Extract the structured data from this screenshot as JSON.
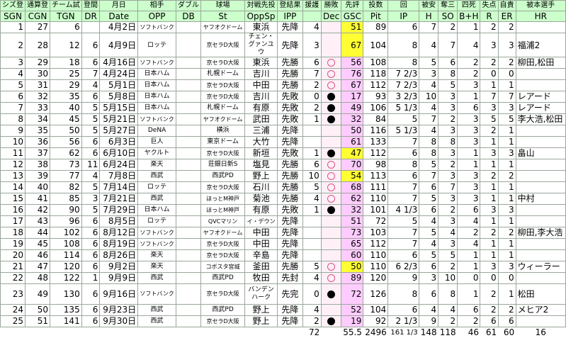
{
  "header_top": [
    "シズ登",
    "通算登",
    "チーム試",
    "登間",
    "月日",
    "相手",
    "ダブル",
    "球場",
    "対戦先投",
    "登結果",
    "援護",
    "勝敗",
    "先評",
    "投数",
    "回",
    "被安",
    "奪三",
    "四死",
    "失点",
    "自責",
    "被本選手"
  ],
  "header_sub": [
    "SGN",
    "CGN",
    "TGN",
    "DR",
    "Date",
    "OPP",
    "DB",
    "St",
    "OppSp",
    "IPP",
    "",
    "Dec",
    "GSC",
    "Pit",
    "IP",
    "H",
    "SO",
    "B+H",
    "R",
    "ER",
    "HR"
  ],
  "rows": [
    {
      "sgn": "1",
      "cgn": "27",
      "tgn": "6",
      "dr": "",
      "date": "4月2日",
      "opp": "ソフトバンク",
      "db": "",
      "st": "ヤフオクドーム",
      "oppsp": "東浜",
      "ipp": "先降",
      "sup": "4",
      "dec": "",
      "gsc": "51",
      "gscbg": "y",
      "pit": "89",
      "ip": "6",
      "h": "7",
      "so": "2",
      "bh": "1",
      "r": "2",
      "er": "2",
      "hr": ""
    },
    {
      "sgn": "2",
      "cgn": "28",
      "tgn": "12",
      "dr": "6",
      "date": "4月9日",
      "opp": "ロッテ",
      "db": "",
      "st": "京セラD大阪",
      "oppsp": "チェン・グァンユウ",
      "ipp": "先降",
      "sup": "3",
      "dec": "",
      "gsc": "67",
      "gscbg": "y",
      "pit": "104",
      "ip": "8",
      "h": "4",
      "so": "7",
      "bh": "4",
      "r": "3",
      "er": "3",
      "hr": "福浦2"
    },
    {
      "sgn": "3",
      "cgn": "29",
      "tgn": "18",
      "dr": "6",
      "date": "4月16日",
      "opp": "ソフトバンク",
      "db": "",
      "st": "京セラD大阪",
      "oppsp": "東浜",
      "ipp": "先勝",
      "sup": "6",
      "dec": "win",
      "gsc": "56",
      "gscbg": "p",
      "pit": "108",
      "ip": "8",
      "h": "5",
      "so": "6",
      "bh": "2",
      "r": "2",
      "er": "2",
      "hr": "柳田,松田"
    },
    {
      "sgn": "4",
      "cgn": "30",
      "tgn": "25",
      "dr": "7",
      "date": "4月24日",
      "opp": "日本ハム",
      "db": "",
      "st": "札幌ドーム",
      "oppsp": "吉川",
      "ipp": "先勝",
      "sup": "7",
      "dec": "win",
      "gsc": "76",
      "gscbg": "p",
      "pit": "118",
      "ip": "7 2/3",
      "h": "3",
      "so": "8",
      "bh": "2",
      "r": "0",
      "er": "0",
      "hr": ""
    },
    {
      "sgn": "5",
      "cgn": "31",
      "tgn": "29",
      "dr": "4",
      "date": "5月1日",
      "opp": "日本ハム",
      "db": "",
      "st": "京セラD大阪",
      "oppsp": "中田",
      "ipp": "先勝",
      "sup": "2",
      "dec": "win",
      "gsc": "67",
      "gscbg": "p",
      "pit": "112",
      "ip": "7 2/3",
      "h": "4",
      "so": "5",
      "bh": "3",
      "r": "1",
      "er": "1",
      "hr": ""
    },
    {
      "sgn": "6",
      "cgn": "32",
      "tgn": "35",
      "dr": "6",
      "date": "5月8日",
      "opp": "日本ハム",
      "db": "",
      "st": "京セラD大阪",
      "oppsp": "吉川",
      "ipp": "先敗",
      "sup": "0",
      "dec": "loss",
      "gsc": "17",
      "gscbg": "p",
      "pit": "93",
      "ip": "3 2/3",
      "h": "10",
      "so": "3",
      "bh": "1",
      "r": "7",
      "er": "7",
      "hr": "レアード"
    },
    {
      "sgn": "7",
      "cgn": "33",
      "tgn": "40",
      "dr": "5",
      "date": "5月15日",
      "opp": "日本ハム",
      "db": "",
      "st": "札幌ドーム",
      "oppsp": "有原",
      "ipp": "先敗",
      "sup": "2",
      "dec": "loss",
      "gsc": "49",
      "gscbg": "p",
      "pit": "106",
      "ip": "5 1/3",
      "h": "4",
      "so": "3",
      "bh": "6",
      "r": "3",
      "er": "3",
      "hr": "レアード"
    },
    {
      "sgn": "8",
      "cgn": "34",
      "tgn": "45",
      "dr": "5",
      "date": "5月21日",
      "opp": "ソフトバンク",
      "db": "",
      "st": "ヤフオクドーム",
      "oppsp": "武田",
      "ipp": "先敗",
      "sup": "1",
      "dec": "loss",
      "gsc": "32",
      "gscbg": "p",
      "pit": "84",
      "ip": "5",
      "h": "7",
      "so": "2",
      "bh": "3",
      "r": "5",
      "er": "5",
      "hr": "李大浩,松田"
    },
    {
      "sgn": "9",
      "cgn": "35",
      "tgn": "50",
      "dr": "5",
      "date": "5月27日",
      "opp": "DeNA",
      "db": "",
      "st": "横浜",
      "oppsp": "三浦",
      "ipp": "先降",
      "sup": "",
      "dec": "",
      "gsc": "50",
      "gscbg": "p",
      "pit": "116",
      "ip": "5 1/3",
      "h": "4",
      "so": "3",
      "bh": "3",
      "r": "2",
      "er": "1",
      "hr": ""
    },
    {
      "sgn": "10",
      "cgn": "36",
      "tgn": "56",
      "dr": "6",
      "date": "6月3日",
      "opp": "巨人",
      "db": "",
      "st": "東京ドーム",
      "oppsp": "大竹",
      "ipp": "先降",
      "sup": "",
      "dec": "",
      "gsc": "61",
      "gscbg": "p",
      "pit": "133",
      "ip": "7",
      "h": "8",
      "so": "8",
      "bh": "3",
      "r": "1",
      "er": "1",
      "hr": ""
    },
    {
      "sgn": "11",
      "cgn": "37",
      "tgn": "62",
      "dr": "6",
      "date": "6月10日",
      "opp": "ヤクルト",
      "db": "",
      "st": "京セラD大阪",
      "oppsp": "新垣",
      "ipp": "先敗",
      "sup": "1",
      "dec": "loss",
      "gsc": "47",
      "gscbg": "y",
      "pit": "112",
      "ip": "6",
      "h": "8",
      "so": "3",
      "bh": "1",
      "r": "3",
      "er": "3",
      "hr": "畠山"
    },
    {
      "sgn": "12",
      "cgn": "38",
      "tgn": "73",
      "dr": "11",
      "date": "6月24日",
      "opp": "楽天",
      "db": "",
      "st": "荘銀日新S",
      "oppsp": "塩見",
      "ipp": "先勝",
      "sup": "6",
      "dec": "win",
      "gsc": "70",
      "gscbg": "p",
      "pit": "98",
      "ip": "8",
      "h": "5",
      "so": "2",
      "bh": "1",
      "r": "1",
      "er": "1",
      "hr": ""
    },
    {
      "sgn": "13",
      "cgn": "39",
      "tgn": "77",
      "dr": "4",
      "date": "7月8日",
      "opp": "西武",
      "db": "",
      "st": "西武PD",
      "oppsp": "野上",
      "ipp": "先勝",
      "sup": "10",
      "dec": "win",
      "gsc": "54",
      "gscbg": "y",
      "pit": "113",
      "ip": "6",
      "h": "7",
      "so": "3",
      "bh": "3",
      "r": "2",
      "er": "2",
      "hr": ""
    },
    {
      "sgn": "14",
      "cgn": "40",
      "tgn": "82",
      "dr": "5",
      "date": "7月14日",
      "opp": "ロッテ",
      "db": "",
      "st": "京セラD大阪",
      "oppsp": "石川",
      "ipp": "先勝",
      "sup": "5",
      "dec": "win",
      "gsc": "68",
      "gscbg": "p",
      "pit": "111",
      "ip": "7",
      "h": "6",
      "so": "7",
      "bh": "3",
      "r": "1",
      "er": "1",
      "hr": ""
    },
    {
      "sgn": "15",
      "cgn": "41",
      "tgn": "85",
      "dr": "3",
      "date": "7月21日",
      "opp": "西武",
      "db": "",
      "st": "ほっとM神戸",
      "oppsp": "菊池",
      "ipp": "先勝",
      "sup": "4",
      "dec": "win",
      "gsc": "62",
      "gscbg": "p",
      "pit": "110",
      "ip": "7",
      "h": "5",
      "so": "3",
      "bh": "3",
      "r": "1",
      "er": "1",
      "hr": "中村"
    },
    {
      "sgn": "16",
      "cgn": "42",
      "tgn": "90",
      "dr": "5",
      "date": "7月29日",
      "opp": "日本ハム",
      "db": "",
      "st": "ほっとM神戸",
      "oppsp": "有原",
      "ipp": "先敗",
      "sup": "1",
      "dec": "loss",
      "gsc": "32",
      "gscbg": "p",
      "pit": "101",
      "ip": "4 1/3",
      "h": "6",
      "so": "2",
      "bh": "6",
      "r": "3",
      "er": "3",
      "hr": ""
    },
    {
      "sgn": "17",
      "cgn": "43",
      "tgn": "96",
      "dr": "6",
      "date": "8月5日",
      "opp": "ロッテ",
      "db": "",
      "st": "QVCマリン",
      "oppsp": "イ・デウン",
      "ipp": "先降",
      "sup": "",
      "dec": "",
      "gsc": "51",
      "gscbg": "p",
      "pit": "72",
      "ip": "5",
      "h": "4",
      "so": "3",
      "bh": "4",
      "r": "1",
      "er": "1",
      "hr": ""
    },
    {
      "sgn": "18",
      "cgn": "44",
      "tgn": "102",
      "dr": "6",
      "date": "8月12日",
      "opp": "ソフトバンク",
      "db": "",
      "st": "ヤフオクドーム",
      "oppsp": "中田",
      "ipp": "先降",
      "sup": "",
      "dec": "",
      "gsc": "73",
      "gscbg": "p",
      "pit": "103",
      "ip": "7",
      "h": "5",
      "so": "4",
      "bh": "2",
      "r": "2",
      "er": "2",
      "hr": "柳田,李大浩"
    },
    {
      "sgn": "19",
      "cgn": "45",
      "tgn": "108",
      "dr": "6",
      "date": "8月19日",
      "opp": "ソフトバンク",
      "db": "",
      "st": "京セラD大阪",
      "oppsp": "中田",
      "ipp": "先降",
      "sup": "",
      "dec": "",
      "gsc": "65",
      "gscbg": "p",
      "pit": "112",
      "ip": "7",
      "h": "4",
      "so": "3",
      "bh": "4",
      "r": "1",
      "er": "1",
      "hr": ""
    },
    {
      "sgn": "20",
      "cgn": "46",
      "tgn": "114",
      "dr": "6",
      "date": "8月26日",
      "opp": "楽天",
      "db": "",
      "st": "京セラD大阪",
      "oppsp": "辛島",
      "ipp": "先降",
      "sup": "",
      "dec": "",
      "gsc": "60",
      "gscbg": "p",
      "pit": "110",
      "ip": "6",
      "h": "5",
      "so": "5",
      "bh": "1",
      "r": "1",
      "er": "1",
      "hr": ""
    },
    {
      "sgn": "21",
      "cgn": "47",
      "tgn": "120",
      "dr": "6",
      "date": "9月2日",
      "opp": "楽天",
      "db": "",
      "st": "コボスタ宮城",
      "oppsp": "釜田",
      "ipp": "先勝",
      "sup": "5",
      "dec": "win",
      "gsc": "50",
      "gscbg": "y",
      "pit": "110",
      "ip": "6 2/3",
      "h": "6",
      "so": "2",
      "bh": "1",
      "r": "3",
      "er": "3",
      "hr": "ウィーラー"
    },
    {
      "sgn": "22",
      "cgn": "48",
      "tgn": "122",
      "dr": "1",
      "date": "9月9日",
      "opp": "西武",
      "db": "",
      "st": "西武PD",
      "oppsp": "牧田",
      "ipp": "先封",
      "sup": "4",
      "dec": "win",
      "gsc": "89",
      "gscbg": "p",
      "pit": "120",
      "ip": "9",
      "h": "3",
      "so": "10",
      "bh": "0",
      "r": "0",
      "er": "0",
      "hr": ""
    },
    {
      "sgn": "23",
      "cgn": "49",
      "tgn": "130",
      "dr": "6",
      "date": "9月16日",
      "opp": "ソフトバンク",
      "db": "",
      "st": "京セラD大阪",
      "oppsp": "バンデンハーク",
      "ipp": "先完",
      "sup": "0",
      "dec": "loss",
      "gsc": "72",
      "gscbg": "p",
      "pit": "126",
      "ip": "8",
      "h": "6",
      "so": "8",
      "bh": "1",
      "r": "2",
      "er": "1",
      "hr": "松田"
    },
    {
      "sgn": "24",
      "cgn": "50",
      "tgn": "135",
      "dr": "6",
      "date": "9月23日",
      "opp": "西武",
      "db": "",
      "st": "西武PD",
      "oppsp": "野上",
      "ipp": "先降",
      "sup": "4",
      "dec": "",
      "gsc": "52",
      "gscbg": "p",
      "pit": "104",
      "ip": "6",
      "h": "4",
      "so": "4",
      "bh": "6",
      "r": "2",
      "er": "2",
      "hr": "メヒア2"
    },
    {
      "sgn": "25",
      "cgn": "51",
      "tgn": "141",
      "dr": "6",
      "date": "9月30日",
      "opp": "西武",
      "db": "",
      "st": "京セラD大阪",
      "oppsp": "野上",
      "ipp": "先降",
      "sup": "2",
      "dec": "loss",
      "gsc": "19",
      "gscbg": "p",
      "pit": "92",
      "ip": "2 1/3",
      "h": "9",
      "so": "2",
      "bh": "2",
      "r": "6",
      "er": "6",
      "hr": ""
    }
  ],
  "totals": {
    "sup": "72",
    "gsc": "55.5",
    "pit": "2496",
    "ip": "161 1/3",
    "h": "148",
    "so": "118",
    "bh": "46",
    "r": "61",
    "er": "60",
    "hr": "16"
  }
}
